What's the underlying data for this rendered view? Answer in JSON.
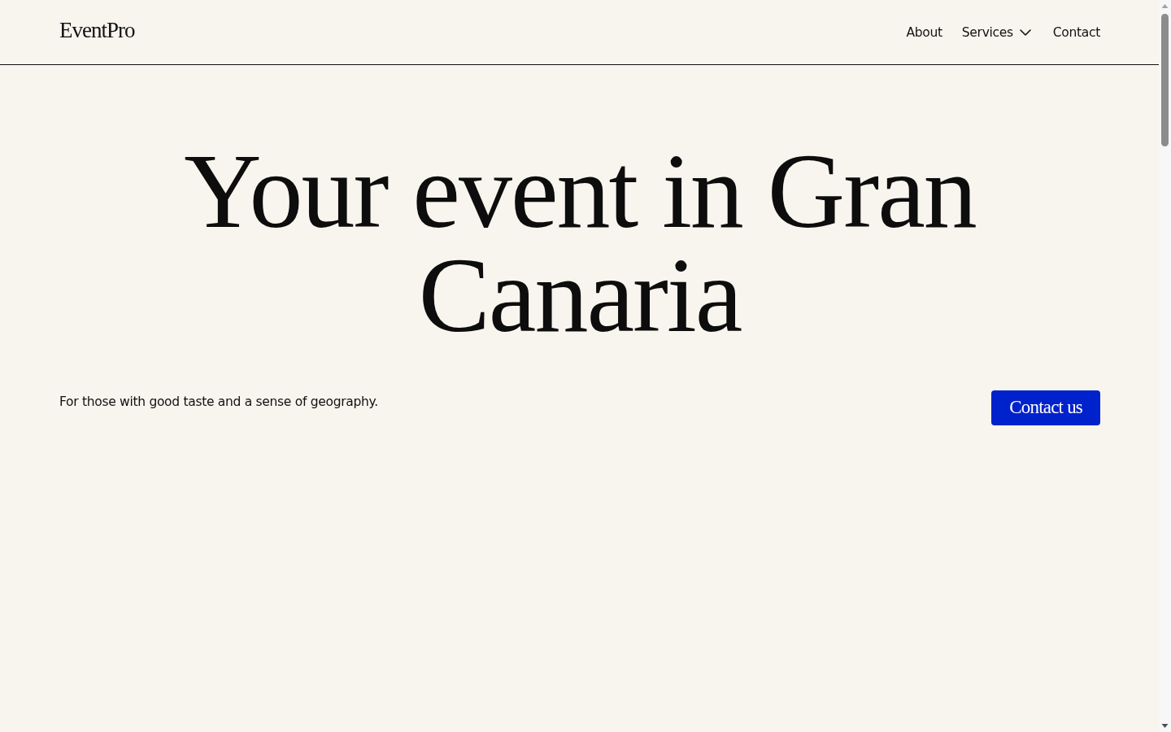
{
  "header": {
    "logo": "EventPro",
    "nav": [
      {
        "label": "About",
        "kind": "link"
      },
      {
        "label": "Services",
        "kind": "dropdown"
      },
      {
        "label": "Contact",
        "kind": "link"
      }
    ]
  },
  "hero": {
    "title": "Your event in Gran Canaria",
    "subtitle": "For those with good taste and a sense of geography.",
    "button": "Contact us"
  }
}
